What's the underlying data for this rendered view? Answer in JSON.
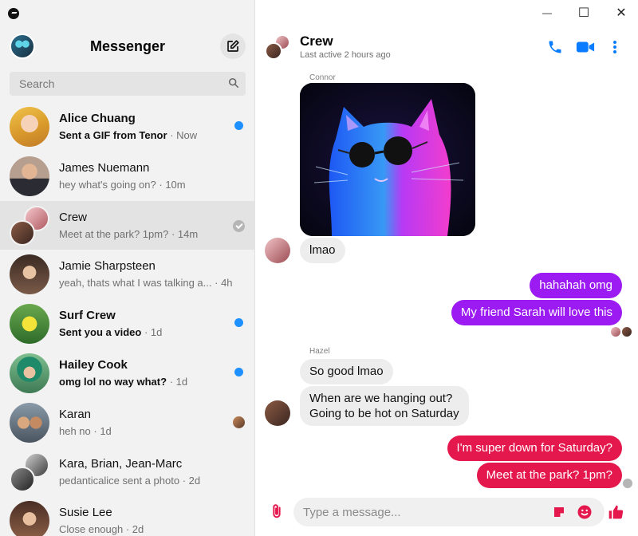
{
  "window": {
    "minimize_glyph": "—",
    "maximize_glyph": "☐",
    "close_glyph": "✕"
  },
  "sidebar": {
    "title": "Messenger",
    "search_placeholder": "Search",
    "conversations": [
      {
        "name": "Alice Chuang",
        "preview": "Sent a GIF from Tenor",
        "time": "· Now",
        "unread": true
      },
      {
        "name": "James Nuemann",
        "preview": "hey what's going on?",
        "time": "· 10m",
        "unread": false
      },
      {
        "name": "Crew",
        "preview": "Meet at the park? 1pm?",
        "time": "· 14m",
        "unread": false,
        "active": true
      },
      {
        "name": "Jamie Sharpsteen",
        "preview": "yeah, thats what I was talking a...",
        "time": "· 4h",
        "unread": false
      },
      {
        "name": "Surf Crew",
        "preview": "Sent you a video",
        "time": "· 1d",
        "unread": true
      },
      {
        "name": "Hailey Cook",
        "preview": "omg lol no way what?",
        "time": "· 1d",
        "unread": true
      },
      {
        "name": "Karan",
        "preview": "heh no",
        "time": "· 1d",
        "unread": false
      },
      {
        "name": "Kara, Brian, Jean-Marc",
        "preview": "pedanticalice sent a photo",
        "time": "· 2d",
        "unread": false
      },
      {
        "name": "Susie Lee",
        "preview": "Close enough",
        "time": "· 2d",
        "unread": false
      }
    ]
  },
  "chat": {
    "title": "Crew",
    "status": "Last active 2 hours ago",
    "sender_connor": "Connor",
    "sender_hazel": "Hazel",
    "messages": {
      "m1": "lmao",
      "m2": "hahahah omg",
      "m3": "My friend Sarah will love this",
      "m4": "So good lmao",
      "m5_line1": "When are we hanging out?",
      "m5_line2": "Going to be hot on Saturday",
      "m6": "I'm super down for Saturday?",
      "m7": "Meet at the park? 1pm?"
    },
    "composer_placeholder": "Type a message..."
  },
  "colors": {
    "accent": "#0a7cff",
    "purple_bubble": "#9b1bf2",
    "red_bubble": "#e4184d",
    "unread_dot": "#1e90ff"
  }
}
